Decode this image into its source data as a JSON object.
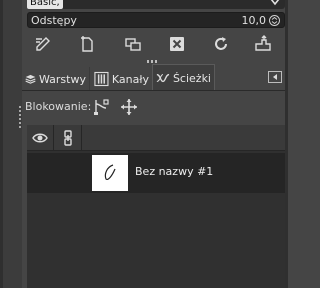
{
  "brush": {
    "selected": "Basic,"
  },
  "spacing": {
    "label": "Odstępy",
    "value": "10,0"
  },
  "toolbar": {
    "icons": [
      "edit-icon",
      "duplicate-icon",
      "copy-icon",
      "delete-icon",
      "refresh-icon",
      "open-icon"
    ]
  },
  "tabs": [
    {
      "label": "Warstwy",
      "icon": "layers-icon"
    },
    {
      "label": "Kanały",
      "icon": "channels-icon"
    },
    {
      "label": "Ścieżki",
      "icon": "paths-icon",
      "active": true
    }
  ],
  "lock": {
    "label": "Blokowanie:"
  },
  "paths": {
    "items": [
      {
        "name": "Bez nazwy #1"
      }
    ]
  },
  "colors": {
    "panel_bg": "#454545",
    "list_bg": "#303030",
    "row_bg": "#252525",
    "text": "#dcdcdc"
  }
}
